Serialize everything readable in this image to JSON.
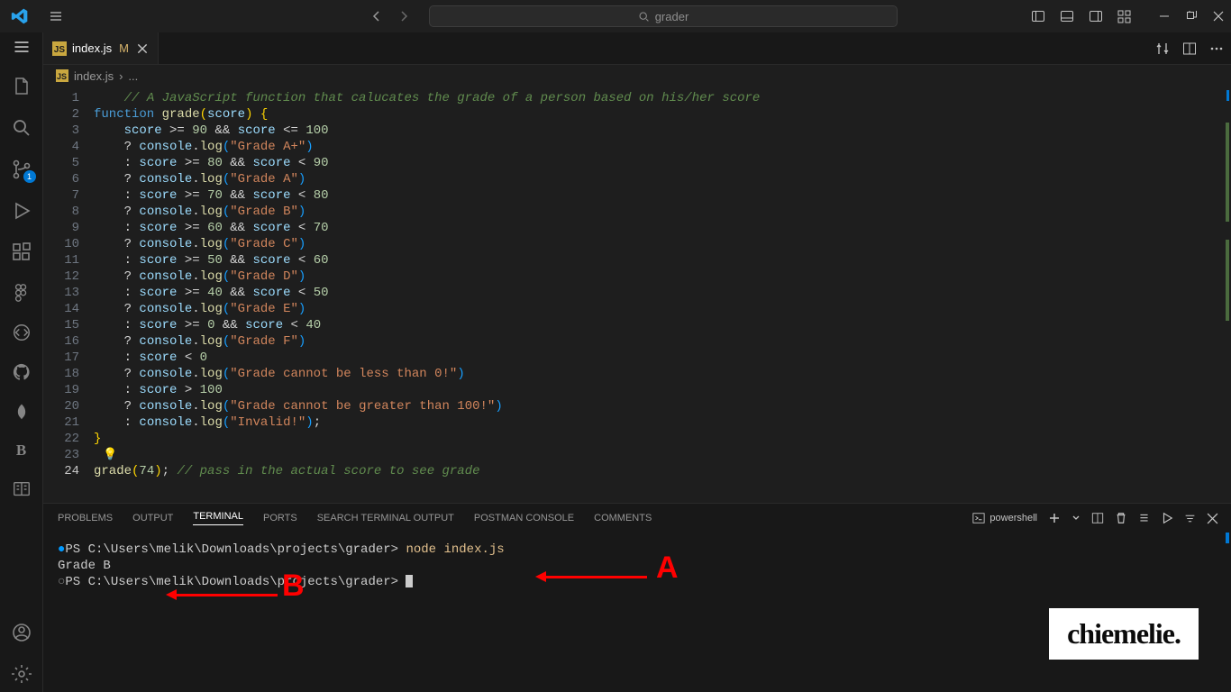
{
  "title_bar": {
    "search_placeholder": "grader"
  },
  "activity_bar": {
    "scm_badge": "1"
  },
  "editor": {
    "tab": {
      "file_icon": "JS",
      "label": "index.js",
      "modified_indicator": "M"
    },
    "breadcrumb": {
      "file_icon": "JS",
      "file": "index.js",
      "sep": "›",
      "rest": "..."
    },
    "gutter_lines": [
      "1",
      "2",
      "3",
      "4",
      "5",
      "6",
      "7",
      "8",
      "9",
      "10",
      "11",
      "12",
      "13",
      "14",
      "15",
      "16",
      "17",
      "18",
      "19",
      "20",
      "21",
      "22",
      "23",
      "24"
    ],
    "code": {
      "l1_comment": "// A JavaScript function that calucates the grade of a person based on his/her score",
      "l2": {
        "kw": "function",
        "fn": "grade",
        "param": "score"
      },
      "cond1": {
        "left": "score >= 90",
        "amp": "&&",
        "right": "score <= 100"
      },
      "log1": "\"Grade A+\"",
      "cond2": {
        "left": "score >= 80",
        "amp": "&&",
        "right": "score < 90"
      },
      "log2": "\"Grade A\"",
      "cond3": {
        "left": "score >= 70",
        "amp": "&&",
        "right": "score < 80"
      },
      "log3": "\"Grade B\"",
      "cond4": {
        "left": "score >= 60",
        "amp": "&&",
        "right": "score < 70"
      },
      "log4": "\"Grade C\"",
      "cond5": {
        "left": "score >= 50",
        "amp": "&&",
        "right": "score < 60"
      },
      "log5": "\"Grade D\"",
      "cond6": {
        "left": "score >= 40",
        "amp": "&&",
        "right": "score < 50"
      },
      "log6": "\"Grade E\"",
      "cond7": {
        "left": "score >= 0",
        "amp": "&&",
        "right": "score < 40"
      },
      "log7": "\"Grade F\"",
      "cond8": "score < 0",
      "log8": "\"Grade cannot be less than 0!\"",
      "cond9": "score > 100",
      "log9": "\"Grade cannot be greater than 100!\"",
      "log10": "\"Invalid!\"",
      "call": {
        "fn": "grade",
        "arg": "74",
        "comment": "// pass in the actual score to see grade"
      },
      "console_obj": "console",
      "log_fn": "log"
    }
  },
  "panel": {
    "tabs": {
      "problems": "PROBLEMS",
      "output": "OUTPUT",
      "terminal": "TERMINAL",
      "ports": "PORTS",
      "search": "SEARCH TERMINAL OUTPUT",
      "postman": "POSTMAN CONSOLE",
      "comments": "COMMENTS"
    },
    "shell_label": "powershell",
    "terminal": {
      "line1_prompt": "PS C:\\Users\\melik\\Downloads\\projects\\grader> ",
      "line1_cmd": "node index.js",
      "line2": "Grade B",
      "line3_prompt": "PS C:\\Users\\melik\\Downloads\\projects\\grader> "
    }
  },
  "annotations": {
    "a": "A",
    "b": "B",
    "watermark": "chiemelie."
  }
}
